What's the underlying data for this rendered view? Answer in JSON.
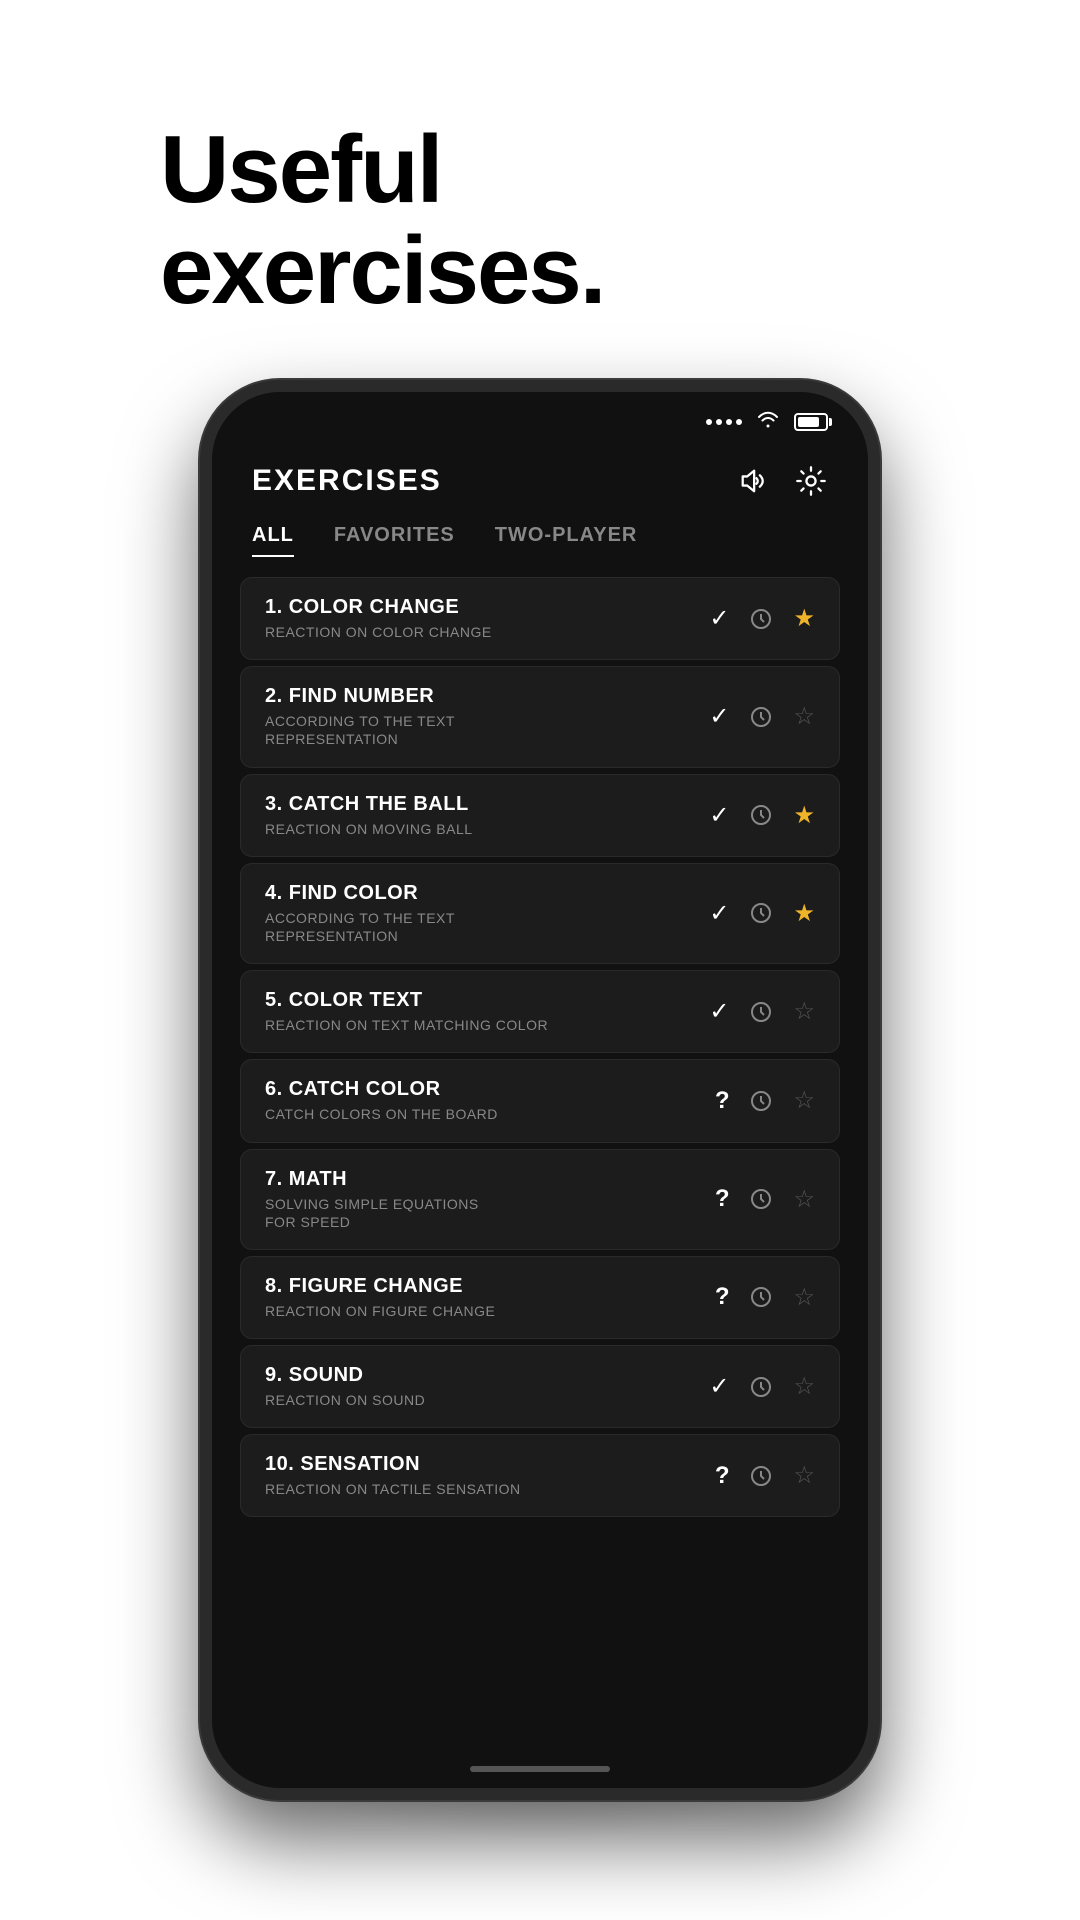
{
  "hero": {
    "line1": "Useful",
    "line2": "exercises."
  },
  "app": {
    "title": "EXERCISES",
    "tabs": [
      {
        "label": "ALL",
        "active": true
      },
      {
        "label": "FAVORITES",
        "active": false
      },
      {
        "label": "TWO-PLAYER",
        "active": false
      }
    ],
    "exercises": [
      {
        "number": "1.",
        "name": "COLOR CHANGE",
        "subtitle": "REACTION ON COLOR CHANGE",
        "status": "check",
        "favorited": true
      },
      {
        "number": "2.",
        "name": "FIND NUMBER",
        "subtitle": "ACCORDING TO THE TEXT\nREPRESENTATION",
        "status": "check",
        "favorited": false
      },
      {
        "number": "3.",
        "name": "CATCH THE BALL",
        "subtitle": "REACTION ON MOVING BALL",
        "status": "check",
        "favorited": true
      },
      {
        "number": "4.",
        "name": "FIND COLOR",
        "subtitle": "ACCORDING TO THE TEXT\nREPRESENTATION",
        "status": "check",
        "favorited": true
      },
      {
        "number": "5.",
        "name": "COLOR TEXT",
        "subtitle": "REACTION ON TEXT MATCHING COLOR",
        "status": "check",
        "favorited": false
      },
      {
        "number": "6.",
        "name": "CATCH COLOR",
        "subtitle": "CATCH COLORS ON THE BOARD",
        "status": "question",
        "favorited": false
      },
      {
        "number": "7.",
        "name": "MATH",
        "subtitle": "SOLVING SIMPLE EQUATIONS\nFOR SPEED",
        "status": "question",
        "favorited": false
      },
      {
        "number": "8.",
        "name": "FIGURE CHANGE",
        "subtitle": "REACTION ON FIGURE CHANGE",
        "status": "question",
        "favorited": false
      },
      {
        "number": "9.",
        "name": "SOUND",
        "subtitle": "REACTION ON SOUND",
        "status": "check",
        "favorited": false
      },
      {
        "number": "10.",
        "name": "SENSATION",
        "subtitle": "REACTION ON TACTILE SENSATION",
        "status": "question",
        "favorited": false
      }
    ]
  }
}
